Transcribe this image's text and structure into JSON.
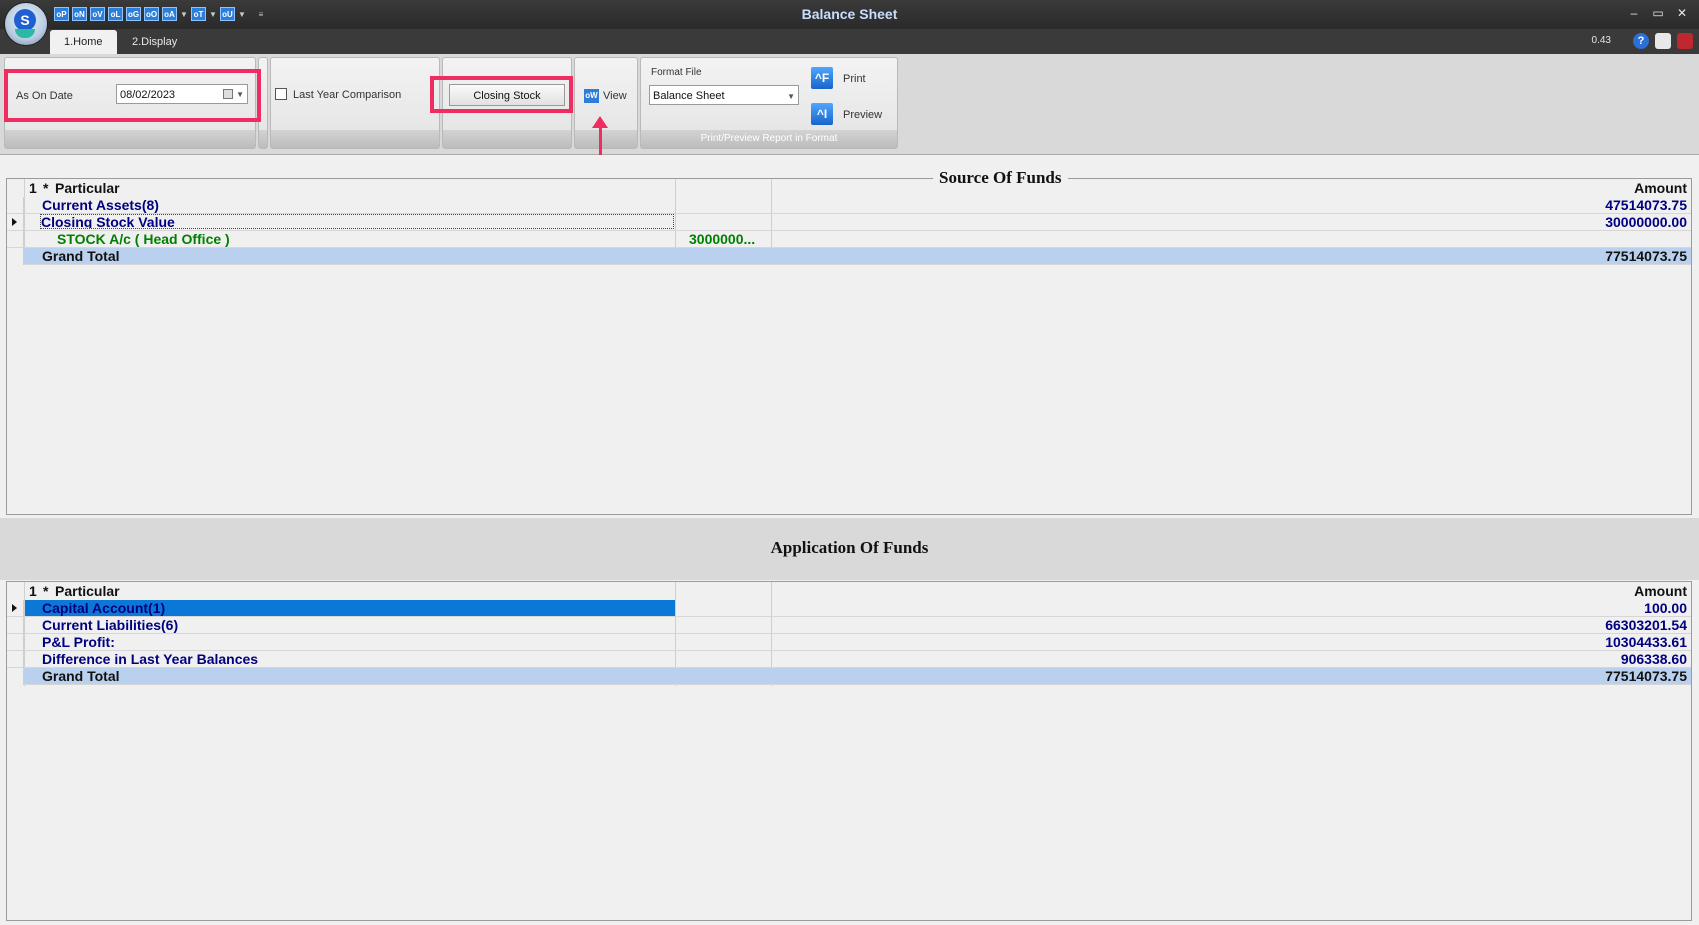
{
  "window": {
    "title": "Balance Sheet"
  },
  "qat": [
    "oP",
    "oN",
    "oV",
    "oL",
    "oG",
    "oO",
    "oA",
    "oT",
    "oU"
  ],
  "tabs": [
    {
      "label": "1.Home"
    },
    {
      "label": "2.Display"
    }
  ],
  "status": {
    "zoom": "0.43"
  },
  "ribbon": {
    "as_on_date_label": "As On Date",
    "as_on_date_value": "08/02/2023",
    "last_year_label": "Last Year Comparison",
    "closing_stock_button": "Closing Stock",
    "view_label": "View",
    "format_file_label": "Format File",
    "format_file_value": "Balance Sheet",
    "print_label": "Print",
    "preview_label": "Preview",
    "print_group_label": "Print/Preview Report in Format"
  },
  "source": {
    "title": "Source Of Funds",
    "col_num": "1",
    "col_star": "*",
    "col_particular": "Particular",
    "col_amount": "Amount",
    "rows": [
      {
        "particular": "Current Assets(8)",
        "mid": "",
        "amount": "47514073.75",
        "color": "#000080"
      },
      {
        "particular": "Closing Stock Value",
        "mid": "",
        "amount": "30000000.00",
        "color": "#000080"
      },
      {
        "particular": "STOCK A/c ( Head Office )",
        "mid": "3000000...",
        "amount": "",
        "color": "#008000"
      }
    ],
    "total": {
      "label": "Grand Total",
      "amount": "77514073.75"
    }
  },
  "application": {
    "title": "Application Of Funds",
    "col_num": "1",
    "col_star": "*",
    "col_particular": "Particular",
    "col_amount": "Amount",
    "rows": [
      {
        "particular": "Capital Account(1)",
        "mid": "",
        "amount": "100.00",
        "color": "#000080"
      },
      {
        "particular": "Current Liabilities(6)",
        "mid": "",
        "amount": "66303201.54",
        "color": "#000080"
      },
      {
        "particular": "P&L Profit:",
        "mid": "",
        "amount": "10304433.61",
        "color": "#000080"
      },
      {
        "particular": "Difference in Last Year Balances",
        "mid": "",
        "amount": "906338.60",
        "color": "#000080"
      }
    ],
    "total": {
      "label": "Grand Total",
      "amount": "77514073.75"
    }
  },
  "colors": {
    "accent_red": "#ef2d62",
    "selected_row": "#0b78d7",
    "total_row": "#b9d1ee"
  }
}
